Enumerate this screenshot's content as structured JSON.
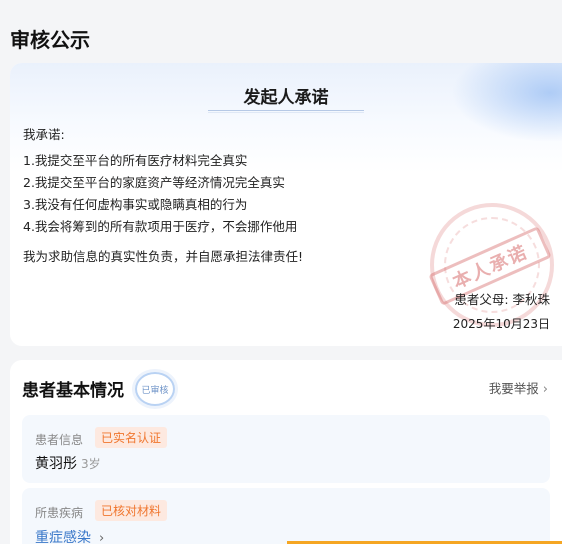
{
  "section_title": "审核公示",
  "promise": {
    "title": "发起人承诺",
    "intro": "我承诺:",
    "items": [
      "1.我提交至平台的所有医疗材料完全真实",
      "2.我提交至平台的家庭资产等经济情况完全真实",
      "3.我没有任何虚构事实或隐瞒真相的行为",
      "4.我会将筹到的所有款项用于医疗，不会挪作他用"
    ],
    "declaration": "我为求助信息的真实性负责，并自愿承担法律责任!",
    "stamp_text": "本人承诺",
    "signer": "患者父母: 李秋珠",
    "date": "2025年10月23日"
  },
  "patient": {
    "title": "患者基本情况",
    "audit_badge": "已审核",
    "report_link": "我要举报",
    "info_label": "患者信息",
    "info_tag": "已实名认证",
    "name": "黄羽彤",
    "age": "3岁",
    "disease_label": "所患疾病",
    "disease_tag": "已核对材料",
    "disease": "重症感染"
  },
  "colors": {
    "accent_blue": "#3a78c9",
    "tag_orange": "#f0762e",
    "tag_bg": "#fde9e0",
    "stamp_red": "#d76e6e",
    "bottom_bar": "#f5a623"
  },
  "icons": {
    "chevron": "chevron-right-icon",
    "audit": "audit-seal-icon",
    "stamp": "promise-stamp-icon"
  }
}
